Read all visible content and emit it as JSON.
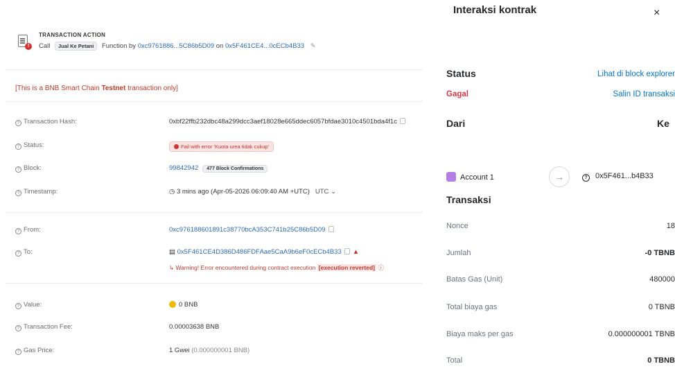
{
  "bscscan": {
    "action": {
      "title": "TRANSACTION ACTION",
      "call": "Call",
      "method_tag": "Jual Ke Petani",
      "function_by": "Function by",
      "from_short": "0xc9761886...5C86b5D09",
      "on": "on",
      "contract_short": "0x5F461CE4...0cECb4B33"
    },
    "testnet_notice": {
      "prefix": "[This is a BNB Smart Chain ",
      "bold": "Testnet",
      "suffix": " transaction only]"
    },
    "rows": {
      "tx_hash": {
        "label": "Transaction Hash:",
        "value": "0xbf22ffb232dbc48a299dcc3aef18028e665ddec6057bfdae3010c4501bda4f1c"
      },
      "status": {
        "label": "Status:",
        "value": "Fail with error 'Kuota urea tidak cukup'"
      },
      "block": {
        "label": "Block:",
        "value": "99842942",
        "confirmations": "477 Block Confirmations"
      },
      "timestamp": {
        "label": "Timestamp:",
        "value": "3 mins ago (Apr-05-2026 06:09:40 AM +UTC)",
        "tz": "UTC"
      },
      "from": {
        "label": "From:",
        "value": "0xc976188601891c38770bcA353C741b25C86b5D09"
      },
      "to": {
        "label": "To:",
        "value": "0x5F461CE4D386D486FDFAae5CaA9b6eF0cECb4B33",
        "warning": "Warning! Error encountered during contract execution",
        "warning_tag": "[execution reverted]"
      },
      "value": {
        "label": "Value:",
        "value": "0 BNB"
      },
      "tx_fee": {
        "label": "Transaction Fee:",
        "value": "0.00003638 BNB"
      },
      "gas_price": {
        "label": "Gas Price:",
        "value": "1 Gwei",
        "sub": "(0.000000001 BNB)"
      }
    }
  },
  "metamask": {
    "title": "Interaksi kontrak",
    "close": "×",
    "status_label": "Status",
    "status_value": "Gagal",
    "explorer_link": "Lihat di block explorer",
    "copy_tx_link": "Salin ID transaksi",
    "from_label": "Dari",
    "to_label": "Ke",
    "from_account": "Account 1",
    "to_address": "0x5F461...b4B33",
    "section_tx": "Transaksi",
    "details": [
      {
        "k": "Nonce",
        "v": "18"
      },
      {
        "k": "Jumlah",
        "v": "-0 TBNB"
      },
      {
        "k": "Batas Gas (Unit)",
        "v": "480000"
      },
      {
        "k": "Total biaya gas",
        "v": "0 TBNB"
      },
      {
        "k": "Biaya maks per gas",
        "v": "0.000000001 TBNB"
      },
      {
        "k": "Total",
        "v": "0 TBNB"
      }
    ]
  }
}
